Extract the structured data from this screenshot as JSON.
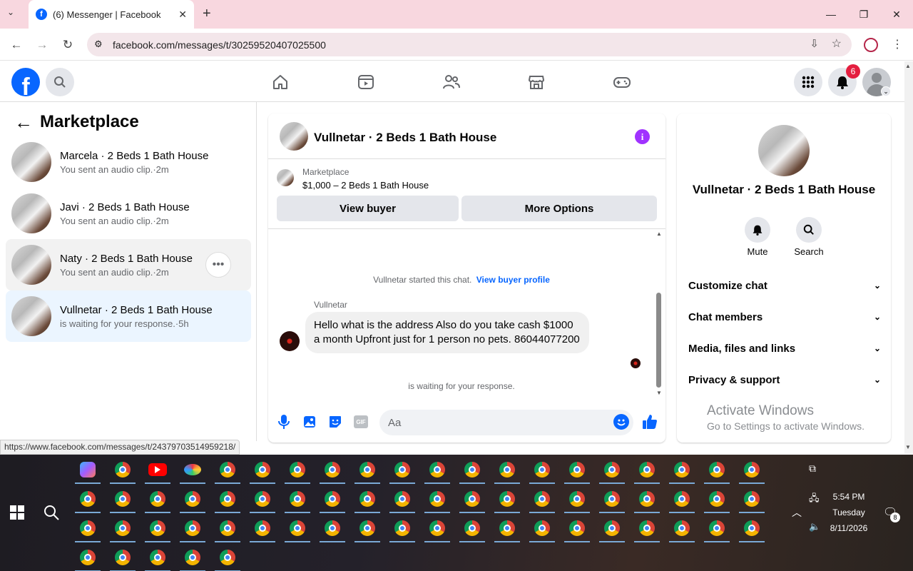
{
  "browser": {
    "tab_title": "(6) Messenger | Facebook",
    "url": "facebook.com/messages/t/30259520407025500",
    "status_url": "https://www.facebook.com/messages/t/24379703514959218/"
  },
  "header": {
    "notification_count": "6"
  },
  "sidebar": {
    "title": "Marketplace",
    "conversations": [
      {
        "name": "Marcela · 2 Beds 1 Bath House",
        "sub": "You sent an audio clip.·2m"
      },
      {
        "name": "Javi · 2 Beds 1 Bath House",
        "sub": "You sent an audio clip.·2m"
      },
      {
        "name": "Naty · 2 Beds 1 Bath House",
        "sub": "You sent an audio clip.·2m"
      },
      {
        "name": "Vullnetar · 2 Beds 1 Bath House",
        "sub": "is waiting for your response.·5h"
      }
    ]
  },
  "chat": {
    "title": "Vullnetar · 2 Beds 1 Bath House",
    "listing_source": "Marketplace",
    "listing_price": "$1,000 – 2 Beds 1 Bath House",
    "view_buyer": "View buyer",
    "more_options": "More Options",
    "started_text": "Vullnetar started this chat.",
    "buyer_profile_link": "View buyer profile",
    "sender": "Vullnetar",
    "message": "Hello what is the address Also do you take cash $1000 a month Upfront just for 1 person no pets. 86044077200",
    "waiting": "is waiting for your response.",
    "composer_placeholder": "Aa",
    "gif_label": "GIF"
  },
  "details": {
    "title": "Vullnetar · 2 Beds 1 Bath House",
    "mute": "Mute",
    "search": "Search",
    "sections": [
      "Customize chat",
      "Chat members",
      "Media, files and links",
      "Privacy & support"
    ],
    "watermark_title": "Activate Windows",
    "watermark_sub": "Go to Settings to activate Windows."
  },
  "taskbar": {
    "time": "5:54 PM",
    "day": "Tuesday",
    "date": "8/11/2026",
    "notif_count": "8"
  },
  "colors": {
    "facebook_blue": "#0866ff",
    "messenger_purple": "#a033ff",
    "badge_red": "#e41e3f"
  }
}
